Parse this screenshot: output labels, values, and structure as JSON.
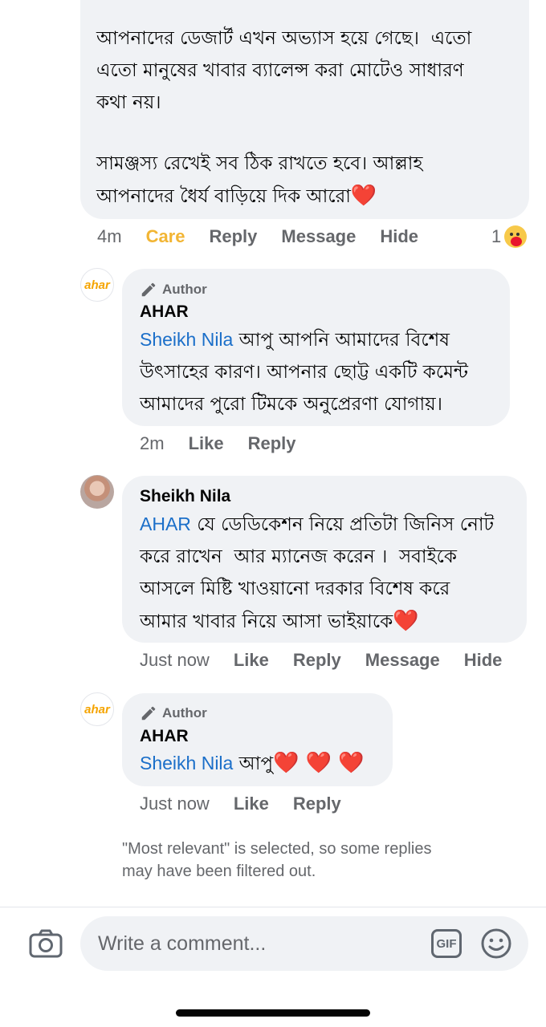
{
  "comment1": {
    "lines": [
      "আপনাদের ডেজার্ট এখন অভ্যাস হয়ে গেছে।  এতো",
      "এতো মানুষের খাবার ব্যালেন্স করা মোটেও সাধারণ",
      "কথা নয়।",
      "সামঞ্জস্য রেখেই সব ঠিক রাখতে হবে। আল্লাহ",
      "আপনাদের ধৈর্য বাড়িয়ে দিক আরো"
    ],
    "heart": "❤️",
    "time": "4m",
    "care_label": "Care",
    "reply_label": "Reply",
    "message_label": "Message",
    "hide_label": "Hide",
    "reaction_count": "1"
  },
  "reply1": {
    "author_tag": "Author",
    "name": "AHAR",
    "mention": "Sheikh Nila",
    "text_first": " আপু আপনি আমাদের বিশেষ",
    "lines": [
      "উৎসাহের কারণ। আপনার ছোট্ট একটি কমেন্ট",
      "আমাদের পুরো টিমকে অনুপ্রেরণা যোগায়।"
    ],
    "time": "2m",
    "like_label": "Like",
    "reply_label": "Reply",
    "avatar_text": "ahar"
  },
  "reply2": {
    "name": "Sheikh Nila",
    "mention": "AHAR",
    "text_first": " যে ডেডিকেশন নিয়ে প্রতিটা জিনিস নোট",
    "lines": [
      "করে রাখেন  আর ম্যানেজ করেন ।  সবাইকে",
      "আসলে মিষ্টি খাওয়ানো দরকার বিশেষ করে",
      "আমার খাবার নিয়ে আসা ভাইয়াকে"
    ],
    "heart": "❤️",
    "time": "Just now",
    "like_label": "Like",
    "reply_label": "Reply",
    "message_label": "Message",
    "hide_label": "Hide"
  },
  "reply3": {
    "author_tag": "Author",
    "name": "AHAR",
    "mention": "Sheikh Nila",
    "text": " আপু",
    "hearts": "❤️ ❤️ ❤️",
    "time": "Just now",
    "like_label": "Like",
    "reply_label": "Reply",
    "avatar_text": "ahar"
  },
  "filter_note": "\"Most relevant\" is selected, so some replies may have been filtered out.",
  "composer": {
    "placeholder": "Write a comment...",
    "gif_label": "GIF"
  },
  "colors": {
    "bubble": "#f0f2f5",
    "mention": "#1b6fc9",
    "care": "#f2b534",
    "meta": "#65676b"
  }
}
